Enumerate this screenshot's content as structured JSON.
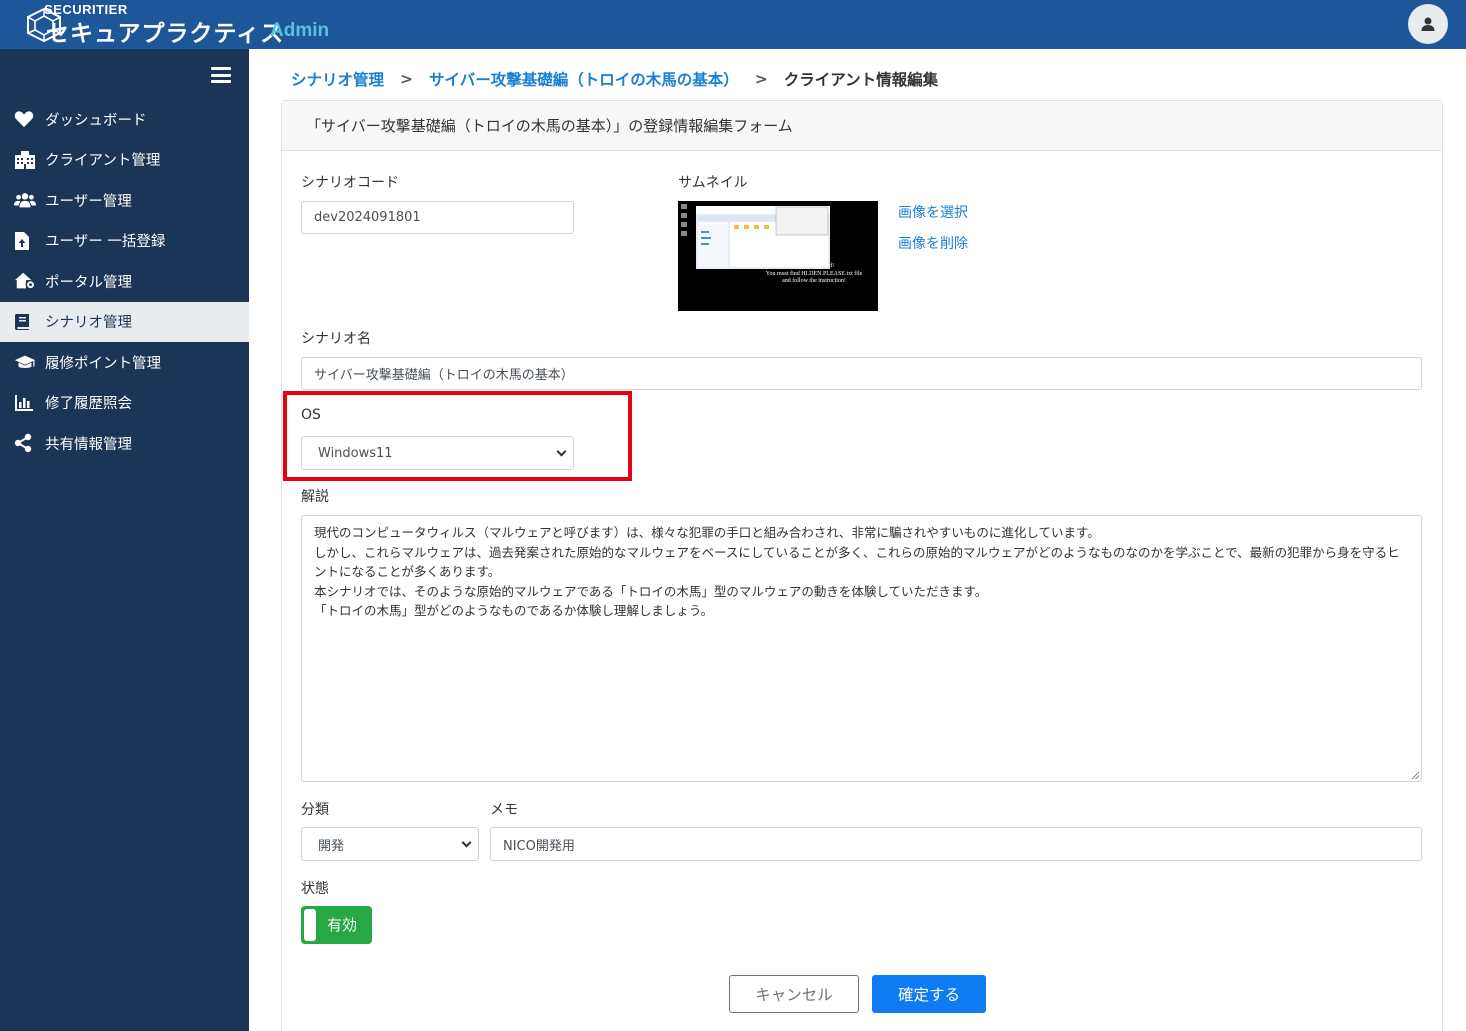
{
  "header": {
    "logo_small": "SECURITIER",
    "logo_main": "セキュアプラクティス",
    "logo_admin": "Admin"
  },
  "sidebar": {
    "items": [
      {
        "label": "ダッシュボード",
        "icon": "heart-icon"
      },
      {
        "label": "クライアント管理",
        "icon": "building-icon"
      },
      {
        "label": "ユーザー管理",
        "icon": "users-icon"
      },
      {
        "label": "ユーザー 一括登録",
        "icon": "file-upload-icon"
      },
      {
        "label": "ポータル管理",
        "icon": "house-gear-icon"
      },
      {
        "label": "シナリオ管理",
        "icon": "book-icon",
        "active": true
      },
      {
        "label": "履修ポイント管理",
        "icon": "graduation-cap-icon"
      },
      {
        "label": "修了履歴照会",
        "icon": "bar-chart-icon"
      },
      {
        "label": "共有情報管理",
        "icon": "share-icon"
      }
    ]
  },
  "breadcrumb": {
    "level1": "シナリオ管理",
    "level2": "サイバー攻撃基礎編（トロイの木馬の基本）",
    "current": "クライアント情報編集",
    "separator": ">"
  },
  "form": {
    "title": "「サイバー攻撃基礎編（トロイの木馬の基本）」の登録情報編集フォーム",
    "scenario_code_label": "シナリオコード",
    "scenario_code_value": "dev2024091801",
    "thumbnail_label": "サムネイル",
    "select_image_link": "画像を選択",
    "delete_image_link": "画像を削除",
    "thumbnail_text": "...and encrypted!\nYou must find HI.DEN.PLEASE.txt file\nand follow the instruction!",
    "scenario_name_label": "シナリオ名",
    "scenario_name_value": "サイバー攻撃基礎編（トロイの木馬の基本）",
    "os_label": "OS",
    "os_value": "Windows11",
    "description_label": "解説",
    "description_lines": [
      "現代のコンピュータウィルス（マルウェアと呼びます）は、様々な犯罪の手口と組み合わされ、非常に騙されやすいものに進化しています。",
      "しかし、これらマルウェアは、過去発案された原始的なマルウェアをベースにしていることが多く、これらの原始的マルウェアがどのようなものなのかを学ぶことで、最新の犯罪から身を守るヒントになることが多くあります。",
      "本シナリオでは、そのような原始的マルウェアである「トロイの木馬」型のマルウェアの動きを体験していただきます。",
      "「トロイの木馬」型がどのようなものであるか体験し理解しましょう。"
    ],
    "category_label": "分類",
    "category_value": "開発",
    "memo_label": "メモ",
    "memo_value": "NICO開発用",
    "status_label": "状態",
    "status_value": "有効",
    "cancel_button": "キャンセル",
    "confirm_button": "確定する"
  },
  "colors": {
    "topbar": "#1e5799",
    "sidebar": "#1b3556",
    "accent": "#1a7fd4",
    "highlight": "#e60012",
    "toggle_on": "#28a745",
    "primary_button": "#0d7bf2"
  }
}
